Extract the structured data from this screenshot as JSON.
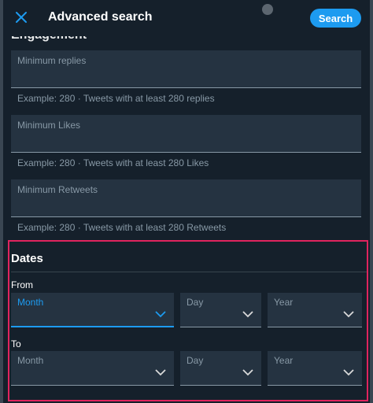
{
  "header": {
    "title": "Advanced search",
    "search_label": "Search"
  },
  "engagement": {
    "section_title": "Engagement",
    "fields": [
      {
        "label": "Minimum replies",
        "hint": "Example: 280 · Tweets with at least 280 replies"
      },
      {
        "label": "Minimum Likes",
        "hint": "Example: 280 · Tweets with at least 280 Likes"
      },
      {
        "label": "Minimum Retweets",
        "hint": "Example: 280 · Tweets with at least 280 Retweets"
      }
    ]
  },
  "dates": {
    "section_title": "Dates",
    "from": {
      "label": "From",
      "month": "Month",
      "day": "Day",
      "year": "Year"
    },
    "to": {
      "label": "To",
      "month": "Month",
      "day": "Day",
      "year": "Year"
    }
  },
  "colors": {
    "background": "#15202b",
    "field": "#253341",
    "accent": "#1d9bf0",
    "highlight_border": "#e0245e",
    "muted_text": "#8899a6"
  },
  "icons": {
    "close": "close-icon",
    "chevron": "chevron-down-icon"
  }
}
